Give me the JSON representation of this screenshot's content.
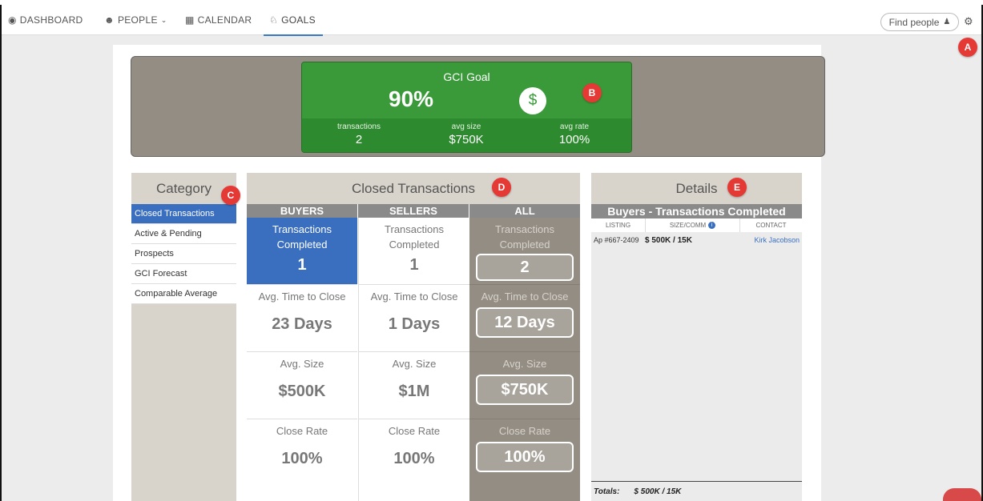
{
  "nav": {
    "items": [
      {
        "label": "DASHBOARD",
        "icon": "tachometer-icon"
      },
      {
        "label": "PEOPLE",
        "icon": "users-icon"
      },
      {
        "label": "CALENDAR",
        "icon": "calendar-icon"
      },
      {
        "label": "GOALS",
        "icon": "trophy-icon"
      }
    ],
    "active": "GOALS",
    "find_people": "Find people"
  },
  "badges": {
    "a": "A",
    "b": "B",
    "c": "C",
    "d": "D",
    "e": "E"
  },
  "goal": {
    "title": "GCI Goal",
    "percent": "90%",
    "symbol": "$",
    "stats": [
      {
        "label": "transactions",
        "value": "2"
      },
      {
        "label": "avg size",
        "value": "$750K"
      },
      {
        "label": "avg rate",
        "value": "100%"
      }
    ]
  },
  "category": {
    "title": "Category",
    "items": [
      "Closed Transactions",
      "Active & Pending",
      "Prospects",
      "GCI Forecast",
      "Comparable Average"
    ],
    "active_index": 0
  },
  "closed": {
    "title": "Closed Transactions",
    "columns": [
      {
        "header": "BUYERS",
        "cells": [
          {
            "label": "Transactions Completed",
            "value": "1"
          },
          {
            "label": "Avg. Time to Close",
            "value": "23 Days"
          },
          {
            "label": "Avg. Size",
            "value": "$500K"
          },
          {
            "label": "Close Rate",
            "value": "100%"
          }
        ]
      },
      {
        "header": "SELLERS",
        "cells": [
          {
            "label": "Transactions Completed",
            "value": "1"
          },
          {
            "label": "Avg. Time to Close",
            "value": "1 Days"
          },
          {
            "label": "Avg. Size",
            "value": "$1M"
          },
          {
            "label": "Close Rate",
            "value": "100%"
          }
        ]
      },
      {
        "header": "ALL",
        "cells": [
          {
            "label": "Transactions Completed",
            "value": "2"
          },
          {
            "label": "Avg. Time to Close",
            "value": "12 Days"
          },
          {
            "label": "Avg. Size",
            "value": "$750K"
          },
          {
            "label": "Close Rate",
            "value": "100%"
          }
        ]
      }
    ]
  },
  "details": {
    "title": "Details",
    "subtitle": "Buyers - Transactions Completed",
    "columns": [
      "LISTING",
      "SIZE/COMM",
      "CONTACT"
    ],
    "rows": [
      {
        "listing": "Ap #667-2409",
        "size": "$ 500K / 15K",
        "contact": "Kirk Jacobson"
      }
    ],
    "totals_label": "Totals:",
    "totals_value": "$ 500K / 15K"
  },
  "colors": {
    "accent_blue": "#3a6fc0",
    "goal_green": "#3a9a3a",
    "badge_red": "#e53935",
    "panel_taupe": "#948d84"
  }
}
